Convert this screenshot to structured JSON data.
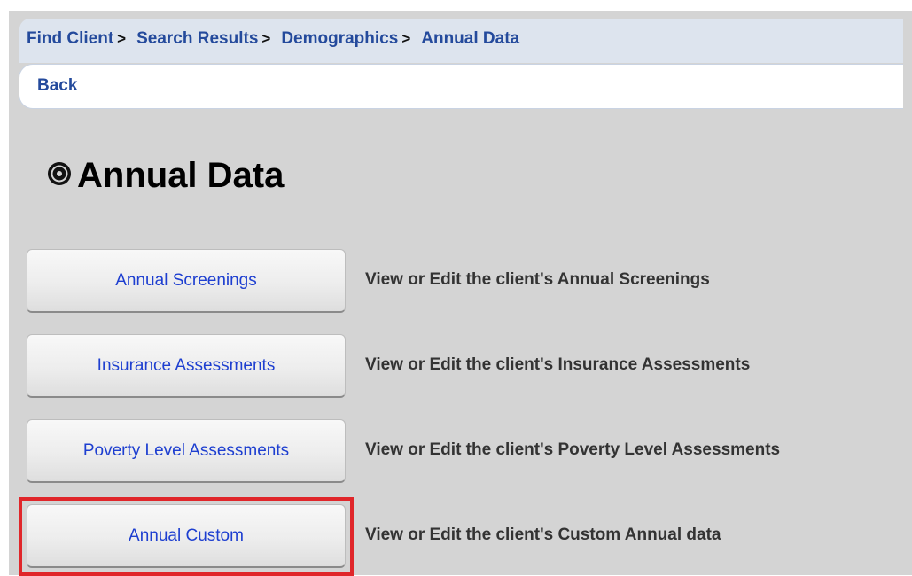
{
  "breadcrumb": {
    "items": [
      "Find Client",
      "Search Results",
      "Demographics",
      "Annual Data"
    ],
    "separator": ">"
  },
  "back_label": "Back",
  "page_title": "Annual Data",
  "title_icon": "gear-icon",
  "actions": [
    {
      "button": "Annual Screenings",
      "description": "View or Edit the client's Annual Screenings"
    },
    {
      "button": "Insurance Assessments",
      "description": "View or Edit the client's Insurance Assessments"
    },
    {
      "button": "Poverty Level Assessments",
      "description": "View or Edit the client's Poverty Level Assessments"
    },
    {
      "button": "Annual Custom",
      "description": "View or Edit the client's Custom Annual data"
    }
  ],
  "colors": {
    "link": "#244a9c",
    "button_text": "#1e3fd0",
    "highlight": "#e0262a",
    "page_bg": "#d4d4d4"
  }
}
